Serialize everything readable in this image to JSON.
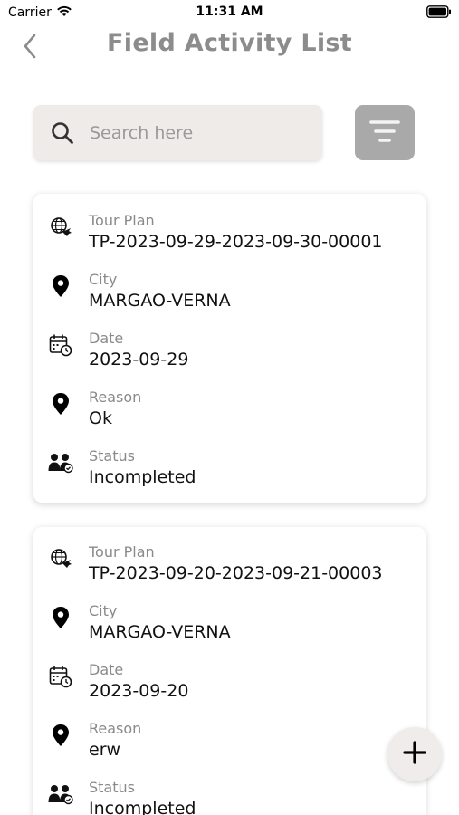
{
  "status_bar": {
    "carrier": "Carrier",
    "time": "11:31 AM"
  },
  "header": {
    "title": "Field Activity List",
    "back_icon": "chevron-left-icon"
  },
  "search": {
    "placeholder": "Search here",
    "value": "",
    "icon": "search-icon"
  },
  "filter": {
    "icon": "filter-lines-icon"
  },
  "records": [
    {
      "tour_plan": {
        "label": "Tour Plan",
        "value": "TP-2023-09-29-2023-09-30-00001"
      },
      "city": {
        "label": "City",
        "value": "MARGAO-VERNA"
      },
      "date": {
        "label": "Date",
        "value": "2023-09-29"
      },
      "reason": {
        "label": "Reason",
        "value": "Ok"
      },
      "status": {
        "label": "Status",
        "value": "Incompleted"
      }
    },
    {
      "tour_plan": {
        "label": "Tour Plan",
        "value": "TP-2023-09-20-2023-09-21-00003"
      },
      "city": {
        "label": "City",
        "value": "MARGAO-VERNA"
      },
      "date": {
        "label": "Date",
        "value": "2023-09-20"
      },
      "reason": {
        "label": "Reason",
        "value": "erw"
      },
      "status": {
        "label": "Status",
        "value": "Incompleted"
      }
    }
  ],
  "fab": {
    "icon": "plus-icon"
  },
  "colors": {
    "title": "#8c8c8c",
    "search_bg": "#efebe9",
    "filter_bg": "#a9a9a9",
    "label": "#8a8a8a",
    "value": "#111111"
  }
}
